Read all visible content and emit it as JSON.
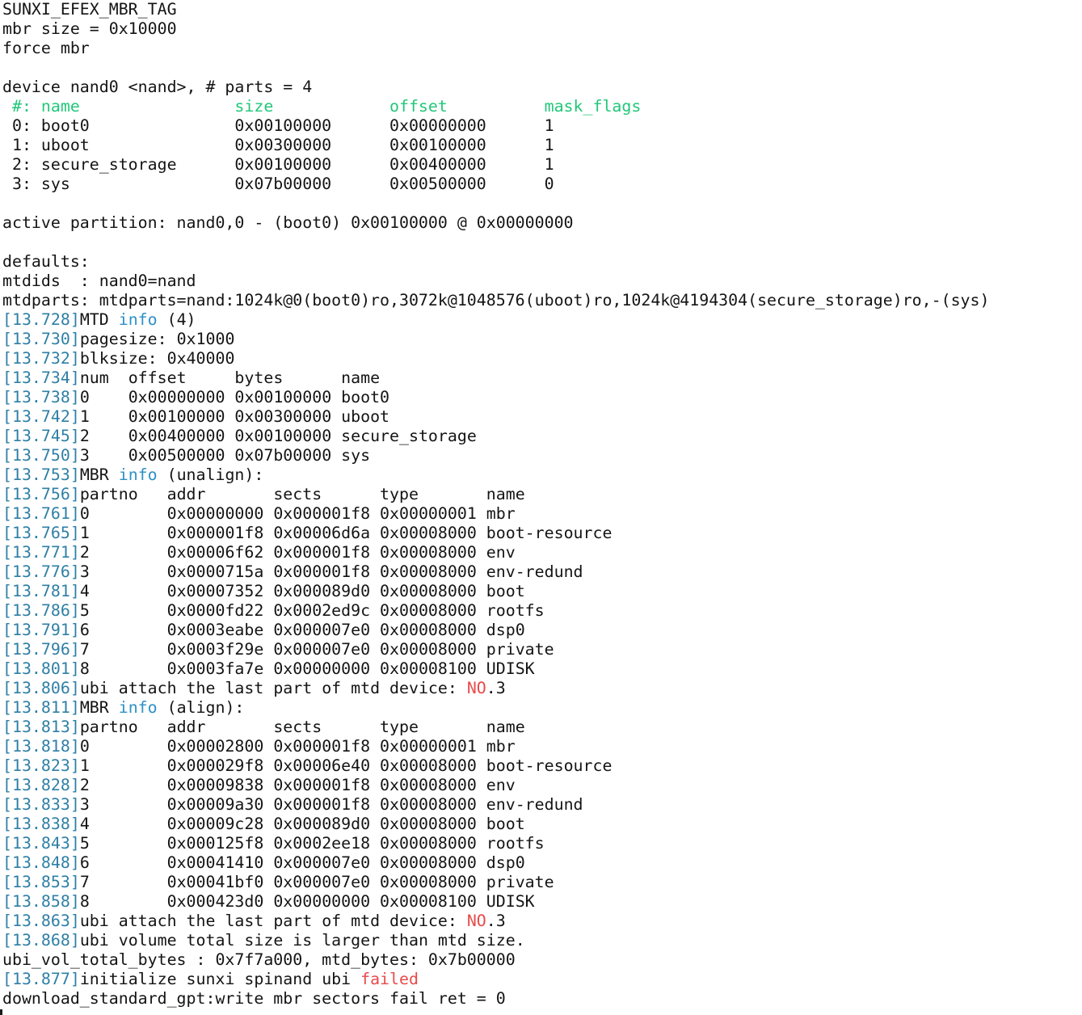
{
  "terminal": {
    "lines": [
      [
        {
          "t": "SUNXI_EFEX_MBR_TAG"
        }
      ],
      [
        {
          "t": "mbr size = 0x10000"
        }
      ],
      [
        {
          "t": "force mbr"
        }
      ],
      [
        {
          "t": ""
        }
      ],
      [
        {
          "t": "device nand0 <nand>, # parts = 4"
        }
      ],
      [
        {
          "t": " #: name                size            offset          mask_flags",
          "s": "hdr"
        }
      ],
      [
        {
          "t": " 0: boot0               0x00100000      0x00000000      1"
        }
      ],
      [
        {
          "t": " 1: uboot               0x00300000      0x00100000      1"
        }
      ],
      [
        {
          "t": " 2: secure_storage      0x00100000      0x00400000      1"
        }
      ],
      [
        {
          "t": " 3: sys                 0x07b00000      0x00500000      0"
        }
      ],
      [
        {
          "t": ""
        }
      ],
      [
        {
          "t": "active partition: nand0,0 - (boot0) 0x00100000 @ 0x00000000"
        }
      ],
      [
        {
          "t": ""
        }
      ],
      [
        {
          "t": "defaults:"
        }
      ],
      [
        {
          "t": "mtdids  : nand0=nand"
        }
      ],
      [
        {
          "t": "mtdparts: mtdparts=nand:1024k@0(boot0)ro,3072k@1048576(uboot)ro,1024k@4194304(secure_storage)ro,-(sys)"
        }
      ],
      [
        {
          "t": "[13.728]",
          "s": "ts"
        },
        {
          "t": "MTD "
        },
        {
          "t": "info",
          "s": "kw"
        },
        {
          "t": " (4)"
        }
      ],
      [
        {
          "t": "[13.730]",
          "s": "ts"
        },
        {
          "t": "pagesize: 0x1000"
        }
      ],
      [
        {
          "t": "[13.732]",
          "s": "ts"
        },
        {
          "t": "blksize: 0x40000"
        }
      ],
      [
        {
          "t": "[13.734]",
          "s": "ts"
        },
        {
          "t": "num  offset     bytes      name"
        }
      ],
      [
        {
          "t": "[13.738]",
          "s": "ts"
        },
        {
          "t": "0    0x00000000 0x00100000 boot0"
        }
      ],
      [
        {
          "t": "[13.742]",
          "s": "ts"
        },
        {
          "t": "1    0x00100000 0x00300000 uboot"
        }
      ],
      [
        {
          "t": "[13.745]",
          "s": "ts"
        },
        {
          "t": "2    0x00400000 0x00100000 secure_storage"
        }
      ],
      [
        {
          "t": "[13.750]",
          "s": "ts"
        },
        {
          "t": "3    0x00500000 0x07b00000 sys"
        }
      ],
      [
        {
          "t": "[13.753]",
          "s": "ts"
        },
        {
          "t": "MBR "
        },
        {
          "t": "info",
          "s": "kw"
        },
        {
          "t": " (unalign):"
        }
      ],
      [
        {
          "t": "[13.756]",
          "s": "ts"
        },
        {
          "t": "partno   addr       sects      type       name"
        }
      ],
      [
        {
          "t": "[13.761]",
          "s": "ts"
        },
        {
          "t": "0        0x00000000 0x000001f8 0x00000001 mbr"
        }
      ],
      [
        {
          "t": "[13.765]",
          "s": "ts"
        },
        {
          "t": "1        0x000001f8 0x00006d6a 0x00008000 boot-resource"
        }
      ],
      [
        {
          "t": "[13.771]",
          "s": "ts"
        },
        {
          "t": "2        0x00006f62 0x000001f8 0x00008000 env"
        }
      ],
      [
        {
          "t": "[13.776]",
          "s": "ts"
        },
        {
          "t": "3        0x0000715a 0x000001f8 0x00008000 env-redund"
        }
      ],
      [
        {
          "t": "[13.781]",
          "s": "ts"
        },
        {
          "t": "4        0x00007352 0x000089d0 0x00008000 boot"
        }
      ],
      [
        {
          "t": "[13.786]",
          "s": "ts"
        },
        {
          "t": "5        0x0000fd22 0x0002ed9c 0x00008000 rootfs"
        }
      ],
      [
        {
          "t": "[13.791]",
          "s": "ts"
        },
        {
          "t": "6        0x0003eabe 0x000007e0 0x00008000 dsp0"
        }
      ],
      [
        {
          "t": "[13.796]",
          "s": "ts"
        },
        {
          "t": "7        0x0003f29e 0x000007e0 0x00008000 private"
        }
      ],
      [
        {
          "t": "[13.801]",
          "s": "ts"
        },
        {
          "t": "8        0x0003fa7e 0x00000000 0x00008100 UDISK"
        }
      ],
      [
        {
          "t": "[13.806]",
          "s": "ts"
        },
        {
          "t": "ubi attach the last part of mtd device: "
        },
        {
          "t": "NO",
          "s": "err"
        },
        {
          "t": ".3"
        }
      ],
      [
        {
          "t": "[13.811]",
          "s": "ts"
        },
        {
          "t": "MBR "
        },
        {
          "t": "info",
          "s": "kw"
        },
        {
          "t": " (align):"
        }
      ],
      [
        {
          "t": "[13.813]",
          "s": "ts"
        },
        {
          "t": "partno   addr       sects      type       name"
        }
      ],
      [
        {
          "t": "[13.818]",
          "s": "ts"
        },
        {
          "t": "0        0x00002800 0x000001f8 0x00000001 mbr"
        }
      ],
      [
        {
          "t": "[13.823]",
          "s": "ts"
        },
        {
          "t": "1        0x000029f8 0x00006e40 0x00008000 boot-resource"
        }
      ],
      [
        {
          "t": "[13.828]",
          "s": "ts"
        },
        {
          "t": "2        0x00009838 0x000001f8 0x00008000 env"
        }
      ],
      [
        {
          "t": "[13.833]",
          "s": "ts"
        },
        {
          "t": "3        0x00009a30 0x000001f8 0x00008000 env-redund"
        }
      ],
      [
        {
          "t": "[13.838]",
          "s": "ts"
        },
        {
          "t": "4        0x00009c28 0x000089d0 0x00008000 boot"
        }
      ],
      [
        {
          "t": "[13.843]",
          "s": "ts"
        },
        {
          "t": "5        0x000125f8 0x0002ee18 0x00008000 rootfs"
        }
      ],
      [
        {
          "t": "[13.848]",
          "s": "ts"
        },
        {
          "t": "6        0x00041410 0x000007e0 0x00008000 dsp0"
        }
      ],
      [
        {
          "t": "[13.853]",
          "s": "ts"
        },
        {
          "t": "7        0x00041bf0 0x000007e0 0x00008000 private"
        }
      ],
      [
        {
          "t": "[13.858]",
          "s": "ts"
        },
        {
          "t": "8        0x000423d0 0x00000000 0x00008100 UDISK"
        }
      ],
      [
        {
          "t": "[13.863]",
          "s": "ts"
        },
        {
          "t": "ubi attach the last part of mtd device: "
        },
        {
          "t": "NO",
          "s": "err"
        },
        {
          "t": ".3"
        }
      ],
      [
        {
          "t": "[13.868]",
          "s": "ts"
        },
        {
          "t": "ubi volume total size is larger than mtd size."
        }
      ],
      [
        {
          "t": "ubi_vol_total_bytes : 0x7f7a000, mtd_bytes: 0x7b00000"
        }
      ],
      [
        {
          "t": "[13.877]",
          "s": "ts"
        },
        {
          "t": "initialize sunxi spinand ubi "
        },
        {
          "t": "failed",
          "s": "err"
        }
      ],
      [
        {
          "t": "download_standard_gpt:write mbr sectors fail ret = 0"
        }
      ]
    ]
  },
  "colors": {
    "background": "#ffffff",
    "text": "#141414",
    "timestamp": "#2e7fa6",
    "keyword_info": "#2e90c8",
    "error": "#e84a4a",
    "table_header": "#22c77a"
  }
}
